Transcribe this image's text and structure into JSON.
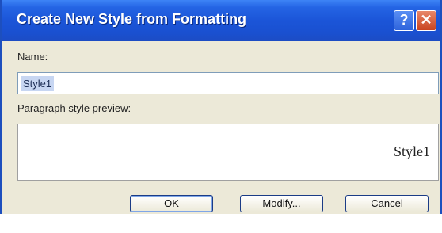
{
  "dialog": {
    "title": "Create New Style from Formatting",
    "help_icon_glyph": "?",
    "close_icon_glyph": "✕"
  },
  "form": {
    "name_label": "Name:",
    "name_value": "Style1",
    "preview_label": "Paragraph style preview:",
    "preview_text": "Style1"
  },
  "buttons": {
    "ok": "OK",
    "modify": "Modify...",
    "cancel": "Cancel"
  },
  "colors": {
    "titlebar": "#1b55d8",
    "dialog_bg": "#ece9d8",
    "close_button": "#c9431f"
  }
}
